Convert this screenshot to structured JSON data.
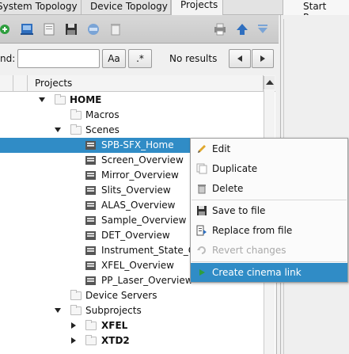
{
  "tabs": [
    {
      "label": "System Topology",
      "active": false
    },
    {
      "label": "Device Topology",
      "active": false
    },
    {
      "label": "Projects",
      "active": true
    }
  ],
  "right_tab": {
    "label": "Start Page"
  },
  "find": {
    "label": "nd:",
    "value": "",
    "match_case_label": "Aa",
    "regex_label": ".*",
    "result_text": "No results",
    "prev_icon": "triangle-left-icon",
    "next_icon": "triangle-right-icon"
  },
  "tree": {
    "header": "Projects",
    "rows": [
      {
        "label": "HOME",
        "bold": true,
        "kind": "folder",
        "expanded": true
      },
      {
        "label": "Macros",
        "bold": false,
        "kind": "folder"
      },
      {
        "label": "Scenes",
        "bold": false,
        "kind": "folder",
        "expanded": true
      },
      {
        "label": "SPB-SFX_Home",
        "bold": false,
        "kind": "scene",
        "selected": true
      },
      {
        "label": "Screen_Overview",
        "kind": "scene"
      },
      {
        "label": "Mirror_Overview",
        "kind": "scene"
      },
      {
        "label": "Slits_Overview",
        "kind": "scene"
      },
      {
        "label": "ALAS_Overview",
        "kind": "scene"
      },
      {
        "label": "Sample_Overview",
        "kind": "scene"
      },
      {
        "label": "DET_Overview",
        "kind": "scene"
      },
      {
        "label": "Instrument_State_Ov",
        "kind": "scene"
      },
      {
        "label": "XFEL_Overview",
        "kind": "scene"
      },
      {
        "label": "PP_Laser_Overview",
        "kind": "scene"
      },
      {
        "label": "Device Servers",
        "kind": "folder"
      },
      {
        "label": "Subprojects",
        "kind": "folder",
        "expanded": true
      },
      {
        "label": "XFEL",
        "bold": true,
        "kind": "folder",
        "expanded": false
      },
      {
        "label": "XTD2",
        "bold": true,
        "kind": "folder",
        "expanded": false
      }
    ]
  },
  "context_menu": {
    "items": [
      {
        "label": "Edit",
        "icon": "pencil-icon",
        "enabled": true
      },
      {
        "label": "Duplicate",
        "icon": "duplicate-icon",
        "enabled": true
      },
      {
        "label": "Delete",
        "icon": "trash-icon",
        "enabled": true
      },
      {
        "label": "Save to file",
        "icon": "save-file-icon",
        "enabled": true
      },
      {
        "label": "Replace from file",
        "icon": "replace-file-icon",
        "enabled": true
      },
      {
        "label": "Revert changes",
        "icon": "revert-icon",
        "enabled": false
      },
      {
        "label": "Create cinema link",
        "icon": "play-icon",
        "enabled": true,
        "highlighted": true
      }
    ]
  },
  "colors": {
    "selection": "#308cc6",
    "toolbar_green": "#2e9e3e",
    "toolbar_blue": "#2f6fbf"
  }
}
